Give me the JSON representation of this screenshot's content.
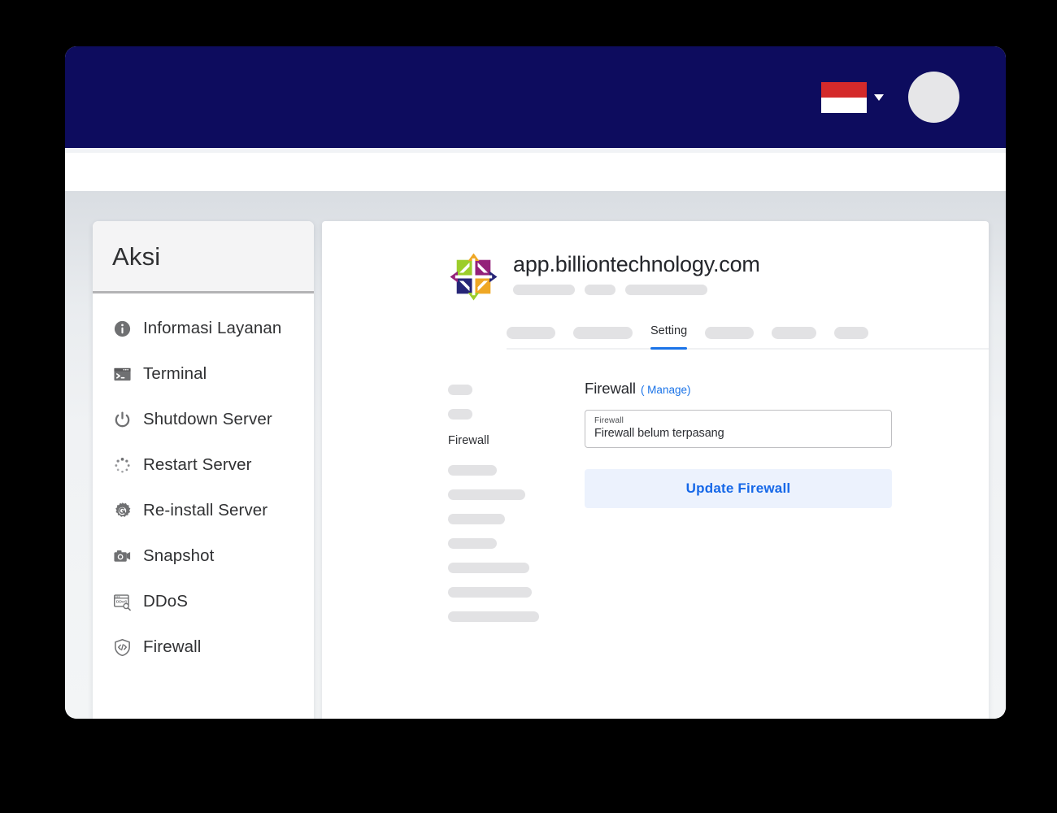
{
  "topbar": {
    "language": {
      "name": "flag-indonesia",
      "label": "Indonesia",
      "colors": {
        "red": "#d42a2a",
        "white": "#ffffff"
      }
    },
    "caret_icon": "chevron-down-icon",
    "avatar_label": "",
    "background_color": "#0d0c5e"
  },
  "sidebar": {
    "title": "Aksi",
    "items": [
      {
        "label": "Informasi Layanan",
        "icon": "info-circle-icon"
      },
      {
        "label": "Terminal",
        "icon": "terminal-icon"
      },
      {
        "label": "Shutdown Server",
        "icon": "power-icon"
      },
      {
        "label": "Restart Server",
        "icon": "spinner-restart-icon"
      },
      {
        "label": "Re-install Server",
        "icon": "gear-wrench-icon"
      },
      {
        "label": "Snapshot",
        "icon": "camera-icon"
      },
      {
        "label": "DDoS",
        "icon": "ddos-window-icon"
      },
      {
        "label": "Firewall",
        "icon": "shield-code-icon"
      }
    ]
  },
  "main": {
    "server": {
      "logo_icon": "centos-logo-icon",
      "domain": "app.billiontechnology.com",
      "meta_placeholders": [
        76,
        38,
        101
      ]
    },
    "tabs": [
      {
        "label": "",
        "placeholder_width": 60,
        "active": false
      },
      {
        "label": "",
        "placeholder_width": 73,
        "active": false
      },
      {
        "label": "Setting",
        "placeholder_width": 0,
        "active": true
      },
      {
        "label": "",
        "placeholder_width": 60,
        "active": false
      },
      {
        "label": "",
        "placeholder_width": 55,
        "active": false
      },
      {
        "label": "",
        "placeholder_width": 42,
        "active": false
      }
    ],
    "left_menu": {
      "above_placeholders": [
        30,
        30
      ],
      "active_label": "Firewall",
      "below_placeholders": [
        60,
        95,
        70,
        60,
        100,
        103,
        112
      ]
    },
    "firewall": {
      "title": "Firewall",
      "manage_link": "( Manage)",
      "field_label": "Firewall",
      "field_value": "Firewall belum terpasang",
      "update_button": "Update Firewall",
      "accent_color": "#1a73e8",
      "button_bg": "#ecf2fd"
    }
  }
}
